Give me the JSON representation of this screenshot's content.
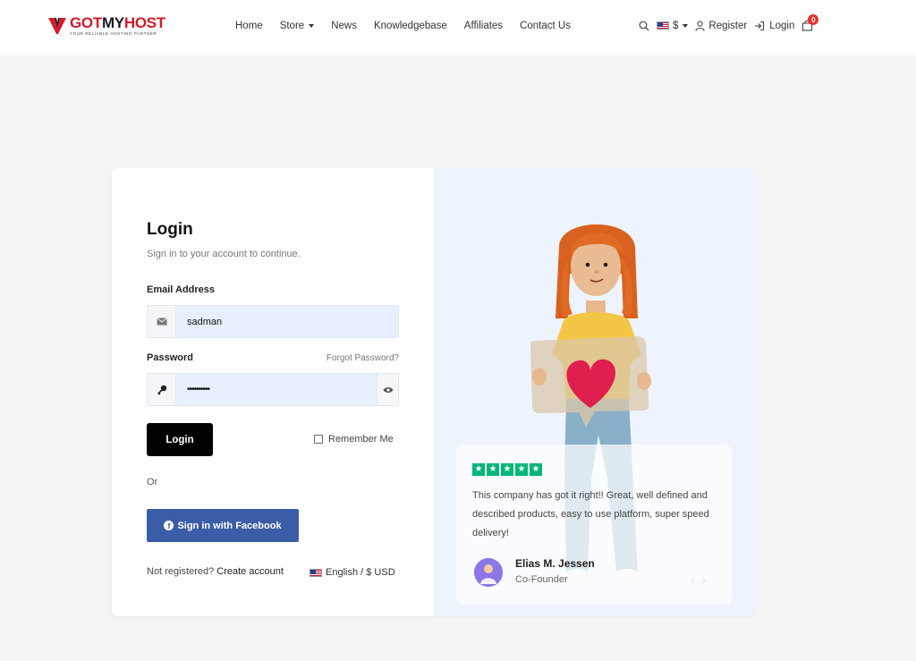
{
  "brand": {
    "name_part1": "GOT",
    "name_part2": "MY",
    "name_part3": "HOST",
    "tagline": "YOUR RELIABLE HOSTING PARTNER",
    "accent": "#d7192a"
  },
  "nav": {
    "items": [
      {
        "label": "Home"
      },
      {
        "label": "Store",
        "has_dropdown": true
      },
      {
        "label": "News"
      },
      {
        "label": "Knowledgebase"
      },
      {
        "label": "Affiliates"
      },
      {
        "label": "Contact Us"
      }
    ]
  },
  "tools": {
    "search_icon": "search-icon",
    "currency": "$",
    "register_label": "Register",
    "login_label": "Login",
    "cart_count": "0"
  },
  "login": {
    "title": "Login",
    "subtitle": "Sign in to your account to continue.",
    "email_label": "Email Address",
    "email_value": "sadman",
    "password_label": "Password",
    "forgot_label": "Forgot Password?",
    "password_value": "••••••••••",
    "submit_label": "Login",
    "remember_label": "Remember Me",
    "or_label": "Or",
    "facebook_label": "Sign in with Facebook",
    "not_registered": "Not registered?",
    "create_account": "Create account",
    "language": "English / $ USD",
    "button_color": "#000000",
    "facebook_color": "#3b5da8"
  },
  "review": {
    "stars": 5,
    "star_color": "#00b67a",
    "text": "This company has got it right!! Great, well defined and described products, easy to use platform, super speed delivery!",
    "name": "Elias M. Jessen",
    "role": "Co-Founder"
  }
}
